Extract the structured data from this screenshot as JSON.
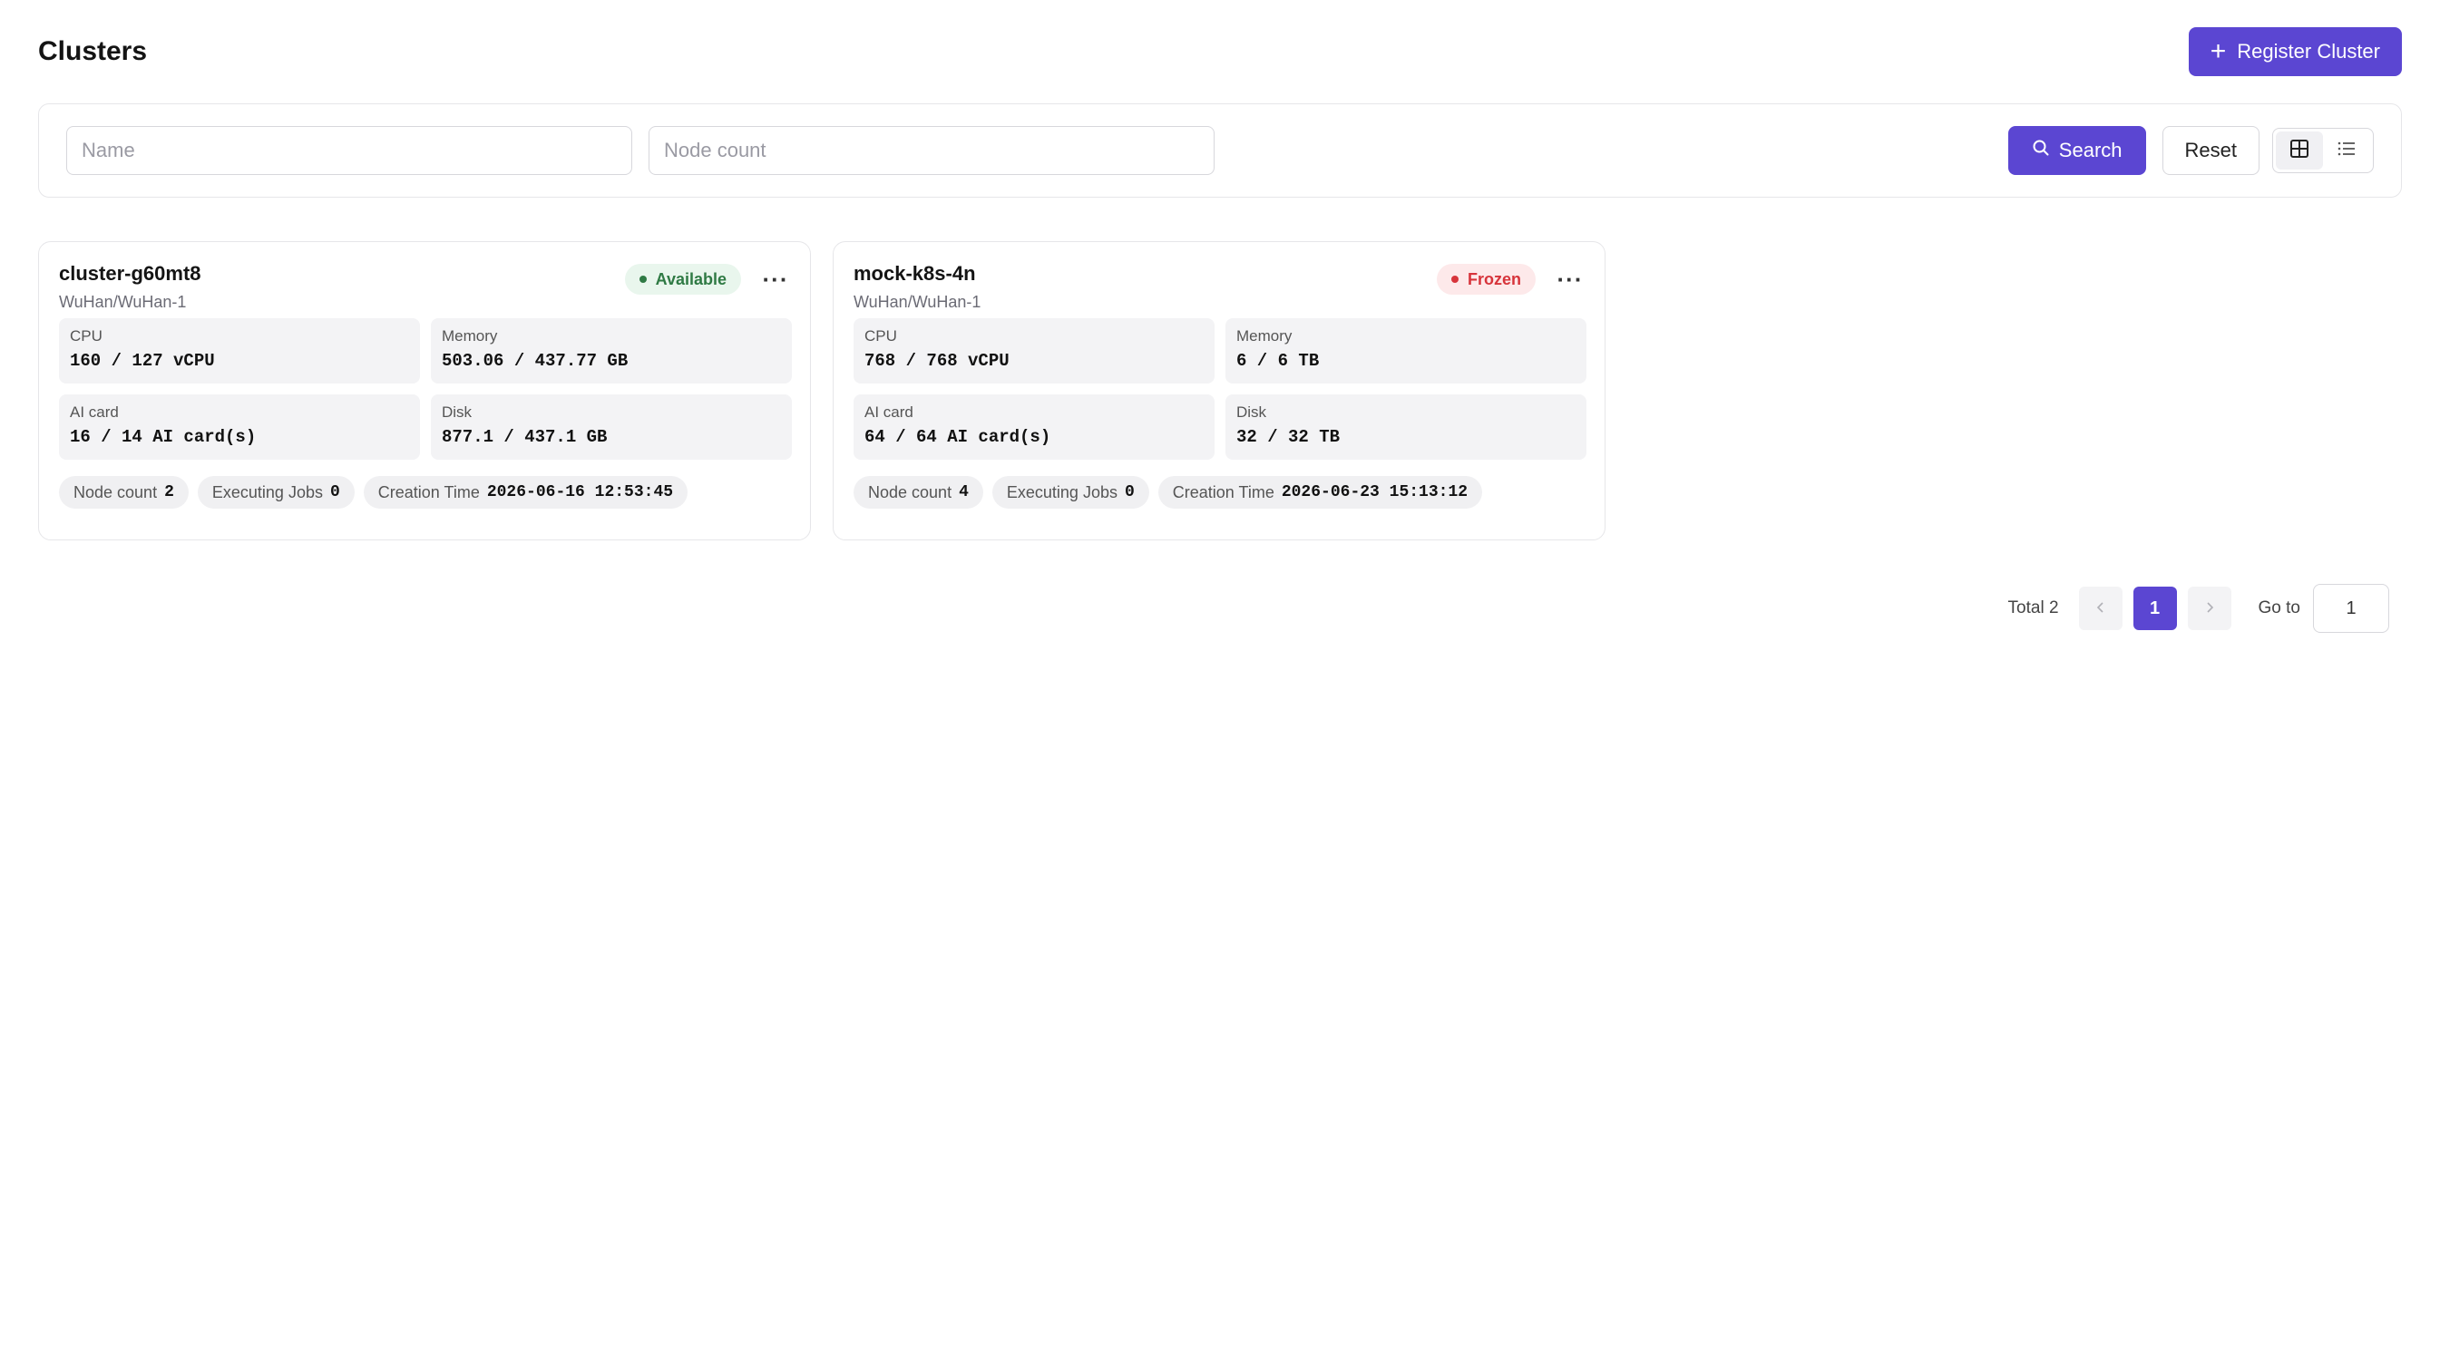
{
  "header": {
    "title": "Clusters",
    "register_label": "Register Cluster"
  },
  "filters": {
    "name_placeholder": "Name",
    "node_count_placeholder": "Node count",
    "search_label": "Search",
    "reset_label": "Reset"
  },
  "view": {
    "active": "grid"
  },
  "clusters": [
    {
      "name": "cluster-g60mt8",
      "region": "WuHan/WuHan-1",
      "status": "Available",
      "cpu_label": "CPU",
      "cpu_value": "160 / 127 vCPU",
      "memory_label": "Memory",
      "memory_value": "503.06 / 437.77 GB",
      "ai_label": "AI card",
      "ai_value": "16 / 14 AI card(s)",
      "disk_label": "Disk",
      "disk_value": "877.1 / 437.1 GB",
      "node_count_label": "Node count",
      "node_count": "2",
      "jobs_label": "Executing Jobs",
      "jobs": "0",
      "created_label": "Creation Time",
      "created": "2026-06-16 12:53:45"
    },
    {
      "name": "mock-k8s-4n",
      "region": "WuHan/WuHan-1",
      "status": "Frozen",
      "cpu_label": "CPU",
      "cpu_value": "768 / 768 vCPU",
      "memory_label": "Memory",
      "memory_value": "6 / 6 TB",
      "ai_label": "AI card",
      "ai_value": "64 / 64 AI card(s)",
      "disk_label": "Disk",
      "disk_value": "32 / 32 TB",
      "node_count_label": "Node count",
      "node_count": "4",
      "jobs_label": "Executing Jobs",
      "jobs": "0",
      "created_label": "Creation Time",
      "created": "2026-06-23 15:13:12"
    }
  ],
  "pagination": {
    "total_label": "Total 2",
    "current_page": "1",
    "goto_label": "Go to",
    "goto_value": "1"
  },
  "colors": {
    "primary": "#5b46d2",
    "available": "#2f7a44",
    "frozen": "#d7343b"
  }
}
